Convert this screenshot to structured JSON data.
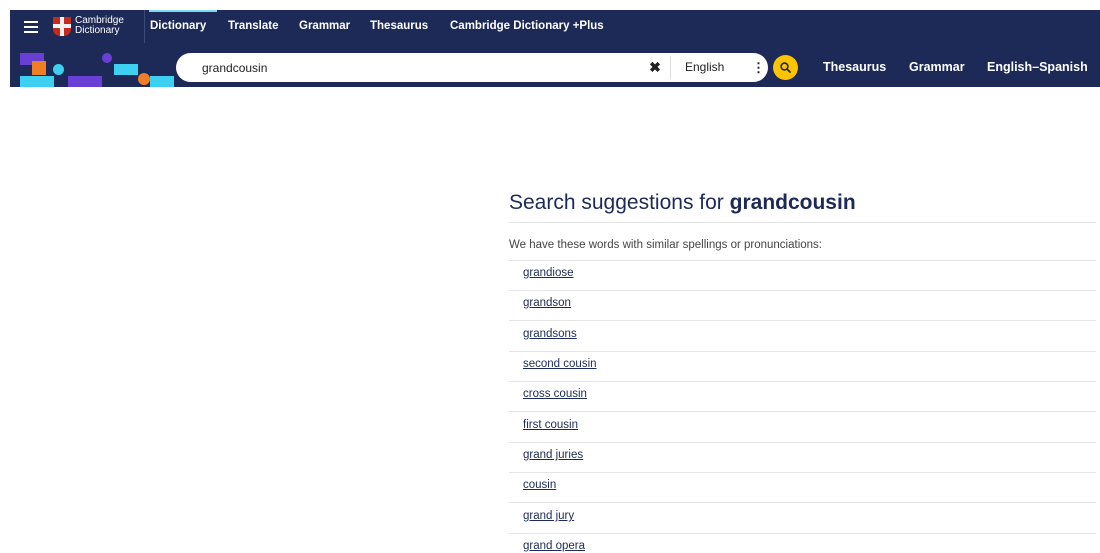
{
  "header": {
    "logo_text": "Cambridge\nDictionary",
    "nav": [
      "Dictionary",
      "Translate",
      "Grammar",
      "Thesaurus",
      "Cambridge Dictionary +Plus"
    ]
  },
  "search": {
    "query": "grandcousin",
    "clear_icon": "✖",
    "language": "English",
    "menu_icon": "⋮"
  },
  "quick_links": [
    "Thesaurus",
    "Grammar",
    "English–Spanish"
  ],
  "results": {
    "heading_prefix": "Search suggestions for",
    "heading_term": "grandcousin",
    "intro": "We have these words with similar spellings or pronunciations:",
    "suggestions": [
      "grandiose",
      "grandson",
      "grandsons",
      "second cousin",
      "cross cousin",
      "first cousin",
      "grand juries",
      "cousin",
      "grand jury",
      "grand opera"
    ]
  },
  "colors": {
    "navy": "#1d2a57",
    "search_button": "#fec400",
    "accent_cyan": "#7ed8f6"
  }
}
